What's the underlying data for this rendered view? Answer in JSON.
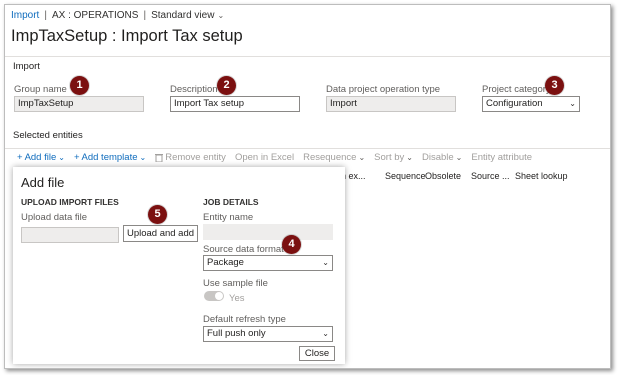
{
  "breadcrumb": {
    "link": "Import",
    "separator": "|",
    "context": "AX : OPERATIONS",
    "view": "Standard view"
  },
  "page_title": "ImpTaxSetup : Import Tax setup",
  "import_section": {
    "heading": "Import",
    "fields": {
      "group_name": {
        "label": "Group name",
        "value": "ImpTaxSetup"
      },
      "description": {
        "label": "Description",
        "value": "Import Tax setup"
      },
      "operation_type": {
        "label": "Data project operation type",
        "value": "Import"
      },
      "project_category": {
        "label": "Project category",
        "value": "Configuration"
      }
    }
  },
  "entities_section": {
    "heading": "Selected entities",
    "toolbar": {
      "add_file": "Add file",
      "add_template": "Add template",
      "remove_entity": "Remove entity",
      "open_in_excel": "Open in Excel",
      "resequence": "Resequence",
      "sort_by": "Sort by",
      "disable": "Disable",
      "entity_attribute": "Entity attribute"
    },
    "columns": [
      "in ex...",
      "Sequence",
      "Obsolete",
      "Source ...",
      "Sheet lookup"
    ]
  },
  "add_file_dialog": {
    "title": "Add file",
    "upload": {
      "heading": "UPLOAD IMPORT FILES",
      "label": "Upload data file",
      "value": "",
      "button": "Upload and add"
    },
    "job": {
      "heading": "JOB DETAILS",
      "entity_name_label": "Entity name",
      "entity_name_value": "",
      "source_format_label": "Source data format",
      "source_format_value": "Package",
      "sample_label": "Use sample file",
      "sample_value": "Yes",
      "refresh_label": "Default refresh type",
      "refresh_value": "Full push only"
    },
    "close_button": "Close"
  },
  "callouts": [
    "1",
    "2",
    "3",
    "4",
    "5"
  ],
  "colors": {
    "accent": "#0f6cbd",
    "callout": "#7b1010",
    "disabled": "#a19f9d"
  }
}
